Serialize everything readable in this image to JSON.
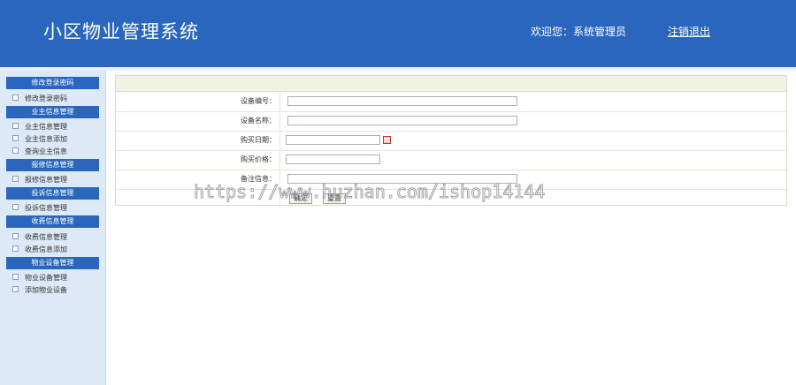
{
  "header": {
    "app_title": "小区物业管理系统",
    "welcome_text": "欢迎您：系统管理员",
    "logout_label": "注销退出"
  },
  "sidebar": {
    "sections": [
      {
        "title": "修改登录密码",
        "items": [
          "修改登录密码"
        ]
      },
      {
        "title": "业主信息管理",
        "items": [
          "业主信息管理",
          "业主信息添加",
          "查询业主信息"
        ]
      },
      {
        "title": "报修信息管理",
        "items": [
          "报修信息管理"
        ]
      },
      {
        "title": "投诉信息管理",
        "items": [
          "投诉信息管理"
        ]
      },
      {
        "title": "收费信息管理",
        "items": [
          "收费信息管理",
          "收费信息添加"
        ]
      },
      {
        "title": "物业设备管理",
        "items": [
          "物业设备管理",
          "添加物业设备"
        ]
      }
    ]
  },
  "form": {
    "device_id_label": "设备编号：",
    "device_name_label": "设备名称：",
    "purchase_date_label": "购买日期：",
    "purchase_price_label": "购买价格：",
    "remark_label": "备注信息：",
    "device_id_value": "",
    "device_name_value": "",
    "purchase_date_value": "",
    "purchase_price_value": "",
    "remark_value": "",
    "submit_label": "确定",
    "reset_label": "重置"
  },
  "watermark": "https://www.huzhan.com/ishop14144",
  "colors": {
    "header_bg": "#2a66bd",
    "sidebar_bg": "#dde9f7",
    "form_head_bg": "#eef3e6"
  }
}
